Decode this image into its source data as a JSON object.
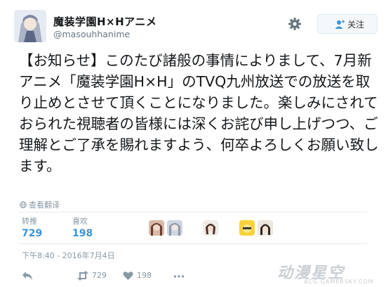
{
  "account": {
    "name": "魔装学園H×Hアニメ",
    "handle": "@masouhhanime",
    "follow_label": "关注"
  },
  "tweet": {
    "text": "【お知らせ】このたび諸般の事情によりまして、7月新アニメ「魔装学園H×H」のTVQ九州放送での放送を取り止めとさせて頂くことになりました。楽しみにされておられた視聴者の皆様には深くお詫び申し上げつつ、ご理解とご了承を賜れますよう、何卒よろしくお願い致します。",
    "translate_label": "查看翻译"
  },
  "stats": {
    "retweets_label": "转推",
    "retweets_count": "729",
    "likes_label": "喜欢",
    "likes_count": "198"
  },
  "timestamp": "下午8:40 - 2016年7月4日",
  "actions": {
    "retweet_count": "729",
    "like_count": "198"
  },
  "watermark": {
    "title": "动漫星空",
    "url": "ACG.GAMERSKY.COM"
  },
  "colors": {
    "link_blue": "#3b94d9",
    "muted_gray": "#8899a6",
    "divider": "#e6ecf0"
  }
}
